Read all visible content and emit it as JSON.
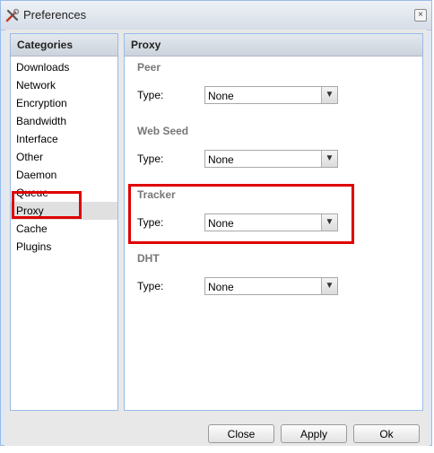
{
  "window": {
    "title": "Preferences",
    "icon": "tools-icon",
    "close_glyph": "×"
  },
  "categories": {
    "header": "Categories",
    "items": [
      {
        "label": "Downloads",
        "selected": false
      },
      {
        "label": "Network",
        "selected": false
      },
      {
        "label": "Encryption",
        "selected": false
      },
      {
        "label": "Bandwidth",
        "selected": false
      },
      {
        "label": "Interface",
        "selected": false
      },
      {
        "label": "Other",
        "selected": false
      },
      {
        "label": "Daemon",
        "selected": false
      },
      {
        "label": "Queue",
        "selected": false
      },
      {
        "label": "Proxy",
        "selected": true
      },
      {
        "label": "Cache",
        "selected": false
      },
      {
        "label": "Plugins",
        "selected": false
      }
    ]
  },
  "proxy": {
    "header": "Proxy",
    "sections": [
      {
        "title": "Peer",
        "type_label": "Type:",
        "type_value": "None"
      },
      {
        "title": "Web Seed",
        "type_label": "Type:",
        "type_value": "None"
      },
      {
        "title": "Tracker",
        "type_label": "Type:",
        "type_value": "None"
      },
      {
        "title": "DHT",
        "type_label": "Type:",
        "type_value": "None"
      }
    ]
  },
  "footer": {
    "close_label": "Close",
    "apply_label": "Apply",
    "ok_label": "Ok"
  },
  "colors": {
    "highlight": "#e00000",
    "panel_border": "#99bbe8",
    "section_title": "#777777"
  }
}
